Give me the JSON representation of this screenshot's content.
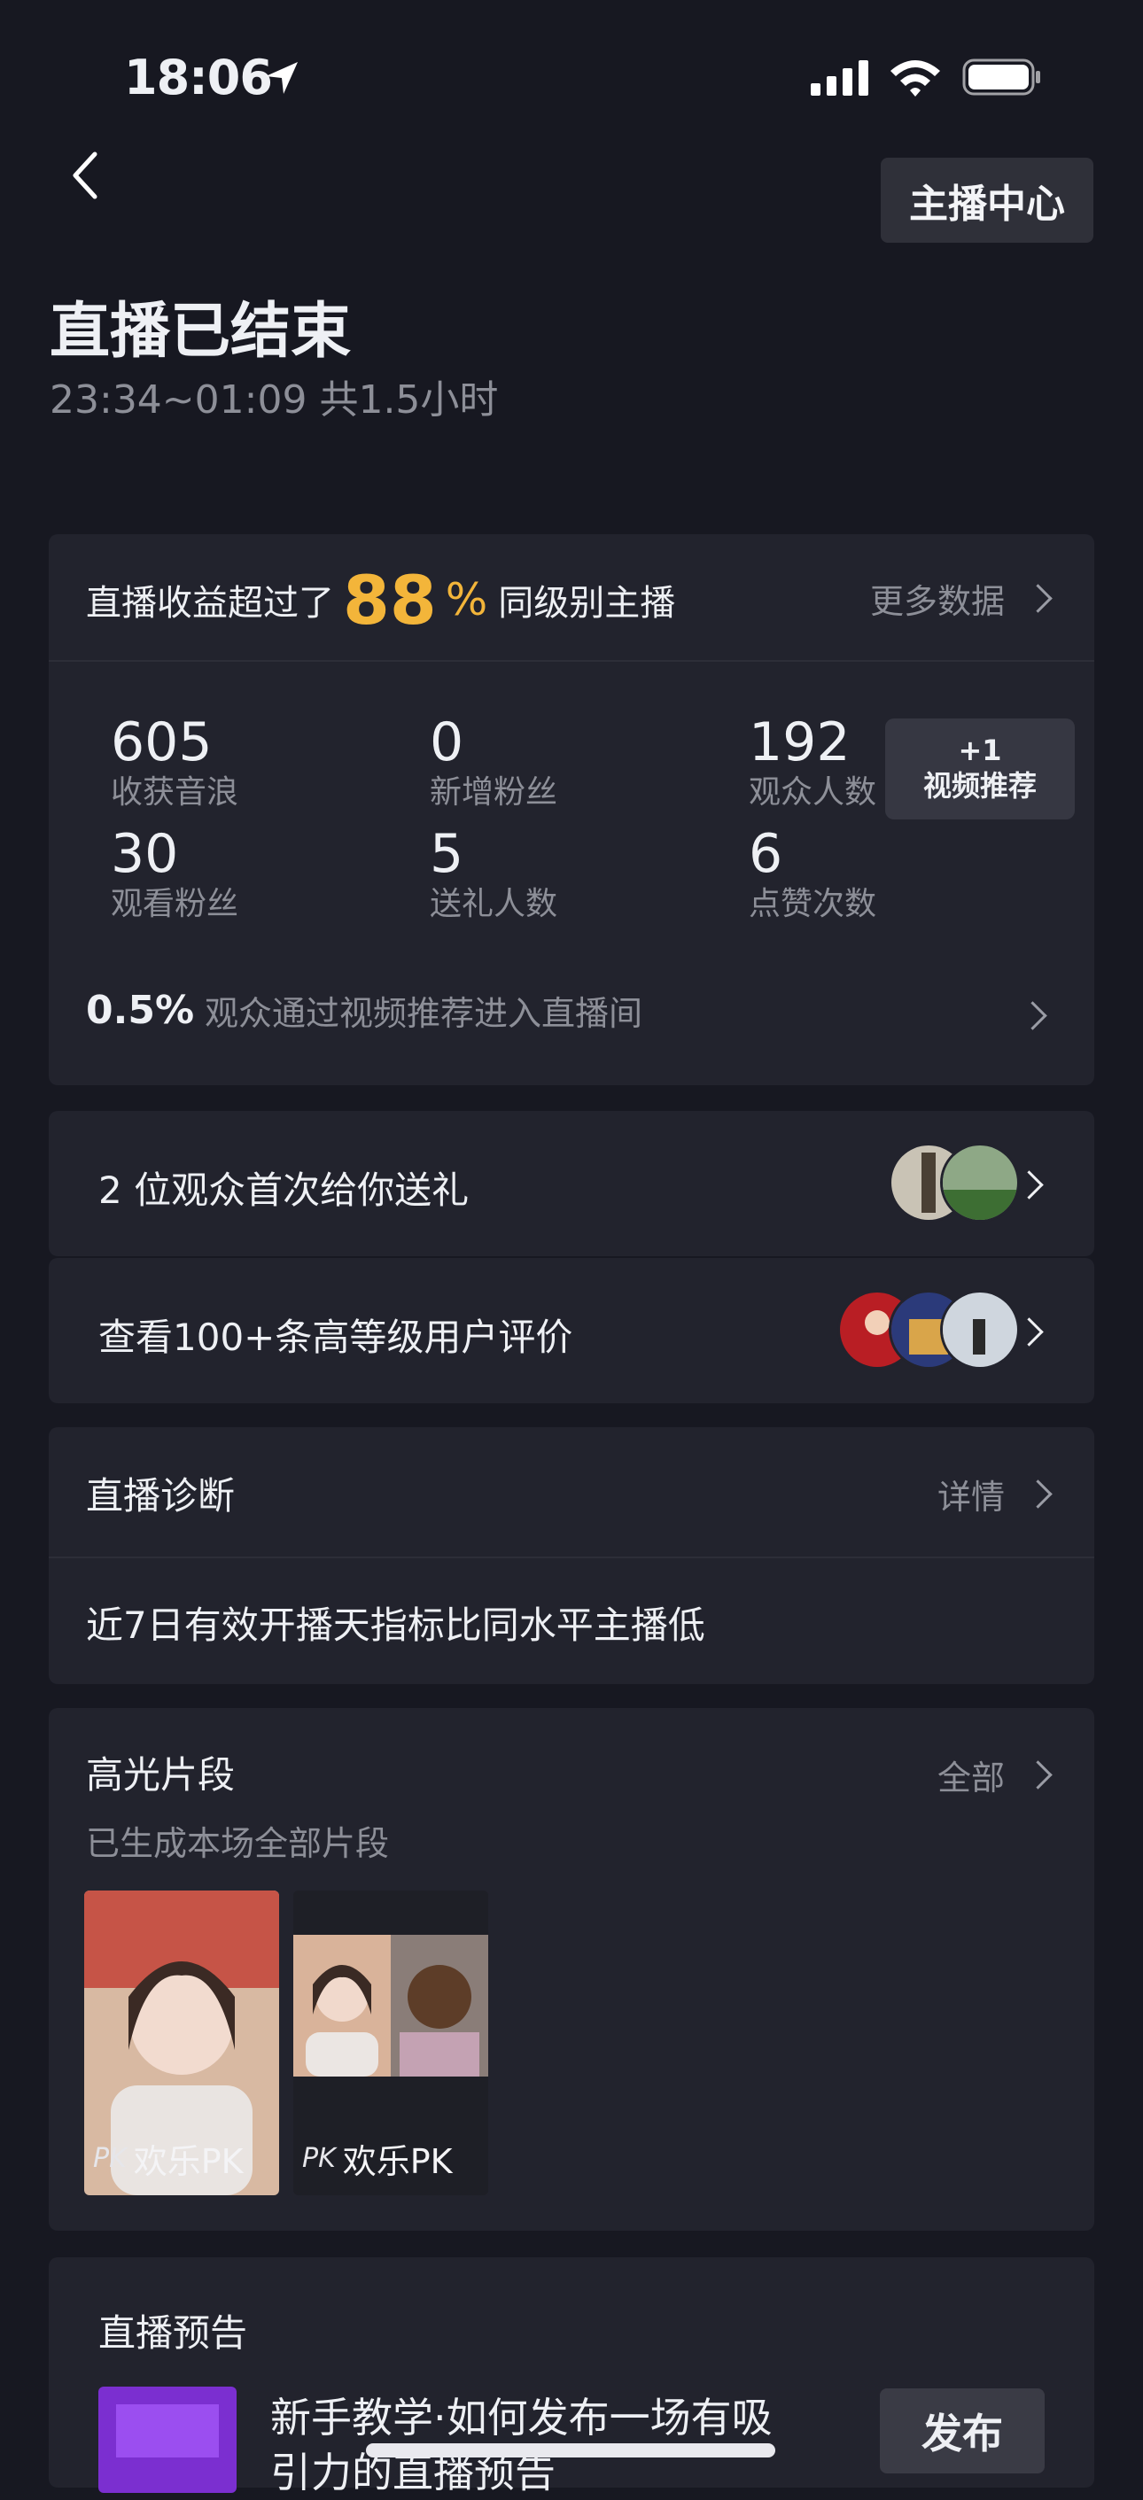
{
  "status_bar": {
    "time": "18:06"
  },
  "header": {
    "anchor_center_label": "主播中心",
    "title": "直播已结束",
    "subtitle": "23:34~01:09 共1.5小时"
  },
  "income": {
    "prefix": "直播收益超过了",
    "percent": "88",
    "percent_sign": "%",
    "suffix": "同级别主播",
    "more_label": "更多数据"
  },
  "stats": [
    {
      "value": "605",
      "label": "收获音浪"
    },
    {
      "value": "0",
      "label": "新增粉丝"
    },
    {
      "value": "192",
      "label": "观众人数"
    },
    {
      "value": "30",
      "label": "观看粉丝"
    },
    {
      "value": "5",
      "label": "送礼人数"
    },
    {
      "value": "6",
      "label": "点赞次数"
    }
  ],
  "rec_badge": {
    "count": "+1",
    "label": "视频推荐"
  },
  "recommend": {
    "percent": "0.5%",
    "text": "观众通过视频推荐进入直播间"
  },
  "gift_row": {
    "text": "2 位观众首次给你送礼"
  },
  "review_row": {
    "text": "查看100+条高等级用户评价"
  },
  "diagnosis": {
    "title": "直播诊断",
    "detail_label": "详情",
    "message": "近7日有效开播天指标比同水平主播低"
  },
  "highlights": {
    "title": "高光片段",
    "all_label": "全部",
    "subtitle": "已生成本场全部片段",
    "clips": [
      {
        "label": "欢乐PK",
        "tag": "PK"
      },
      {
        "label": "欢乐PK",
        "tag": "PK"
      }
    ]
  },
  "preview": {
    "title": "直播预告",
    "text_line1": "新手教学·如何发布一场有吸",
    "text_line2": "引力的直播预告",
    "publish_label": "发布"
  },
  "colors": {
    "background": "#171821",
    "card": "#22232d",
    "accent": "#f3b53a",
    "muted": "#8d8f98"
  }
}
